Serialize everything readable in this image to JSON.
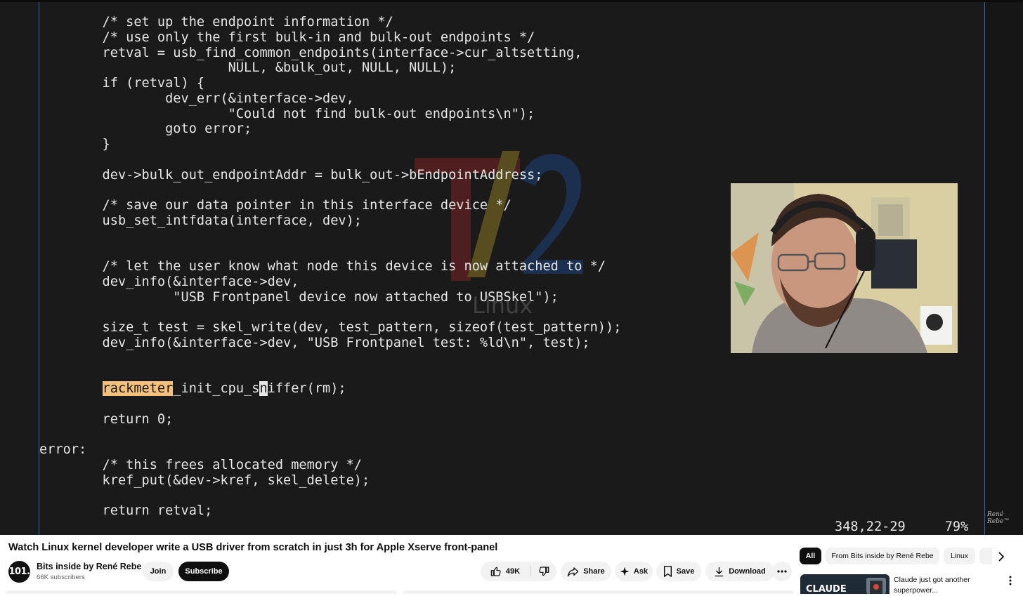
{
  "video": {
    "code_lines": [
      "\t/* set up the endpoint information */",
      "\t/* use only the first bulk-in and bulk-out endpoints */",
      "\tretval = usb_find_common_endpoints(interface->cur_altsetting,",
      "\t\t\tNULL, &bulk_out, NULL, NULL);",
      "\tif (retval) {",
      "\t\tdev_err(&interface->dev,",
      "\t\t\t\"Could not find bulk-out endpoints\\n\");",
      "\t\tgoto error;",
      "\t}",
      "",
      "\tdev->bulk_out_endpointAddr = bulk_out->bEndpointAddress;",
      "",
      "\t/* save our data pointer in this interface device */",
      "\tusb_set_intfdata(interface, dev);",
      "",
      "",
      "\t/* let the user know what node this device is now attached to */",
      "\tdev_info(&interface->dev,",
      "\t\t \"USB Frontpanel device now attached to USBSkel\");",
      "",
      "\tsize_t test = skel_write(dev, test_pattern, sizeof(test_pattern));",
      "\tdev_info(&interface->dev, \"USB Frontpanel test: %ld\\n\", test);",
      "",
      "",
      "\trackmeter_init_cpu_sniffer(rm);",
      "",
      "\treturn 0;",
      "",
      "error:",
      "\t/* this frees allocated memory */",
      "\tkref_put(&dev->kref, skel_delete);",
      "",
      "\treturn retval;"
    ],
    "highlight": {
      "line": 24,
      "word": "rackmeter"
    },
    "cursor": {
      "line": 24,
      "char": "n"
    },
    "watermark_text": "Linux",
    "status_position": "348,22-29",
    "status_percent": "79%",
    "signature": "René Rebe™"
  },
  "title": "Watch Linux kernel developer write a USB driver from scratch in just 3h for Apple Xserve front-panel",
  "channel": {
    "avatar_text": "101.",
    "name": "Bits inside by René Rebe",
    "subscribers": "66K subscribers",
    "join_label": "Join",
    "subscribe_label": "Subscribe"
  },
  "actions": {
    "like_count": "49K",
    "share_label": "Share",
    "ask_label": "Ask",
    "save_label": "Save",
    "download_label": "Download"
  },
  "chips": [
    "All",
    "From Bits inside by René Rebe",
    "Linux"
  ],
  "recommendation": {
    "thumb_text": "CLAUDE",
    "title": "Claude just got another superpower..."
  },
  "colors": {
    "editor_bg": "#1a1a1a",
    "editor_text": "#e6e6e6",
    "search_highlight": "#f5c07a",
    "split_line": "#2b6cb0"
  }
}
